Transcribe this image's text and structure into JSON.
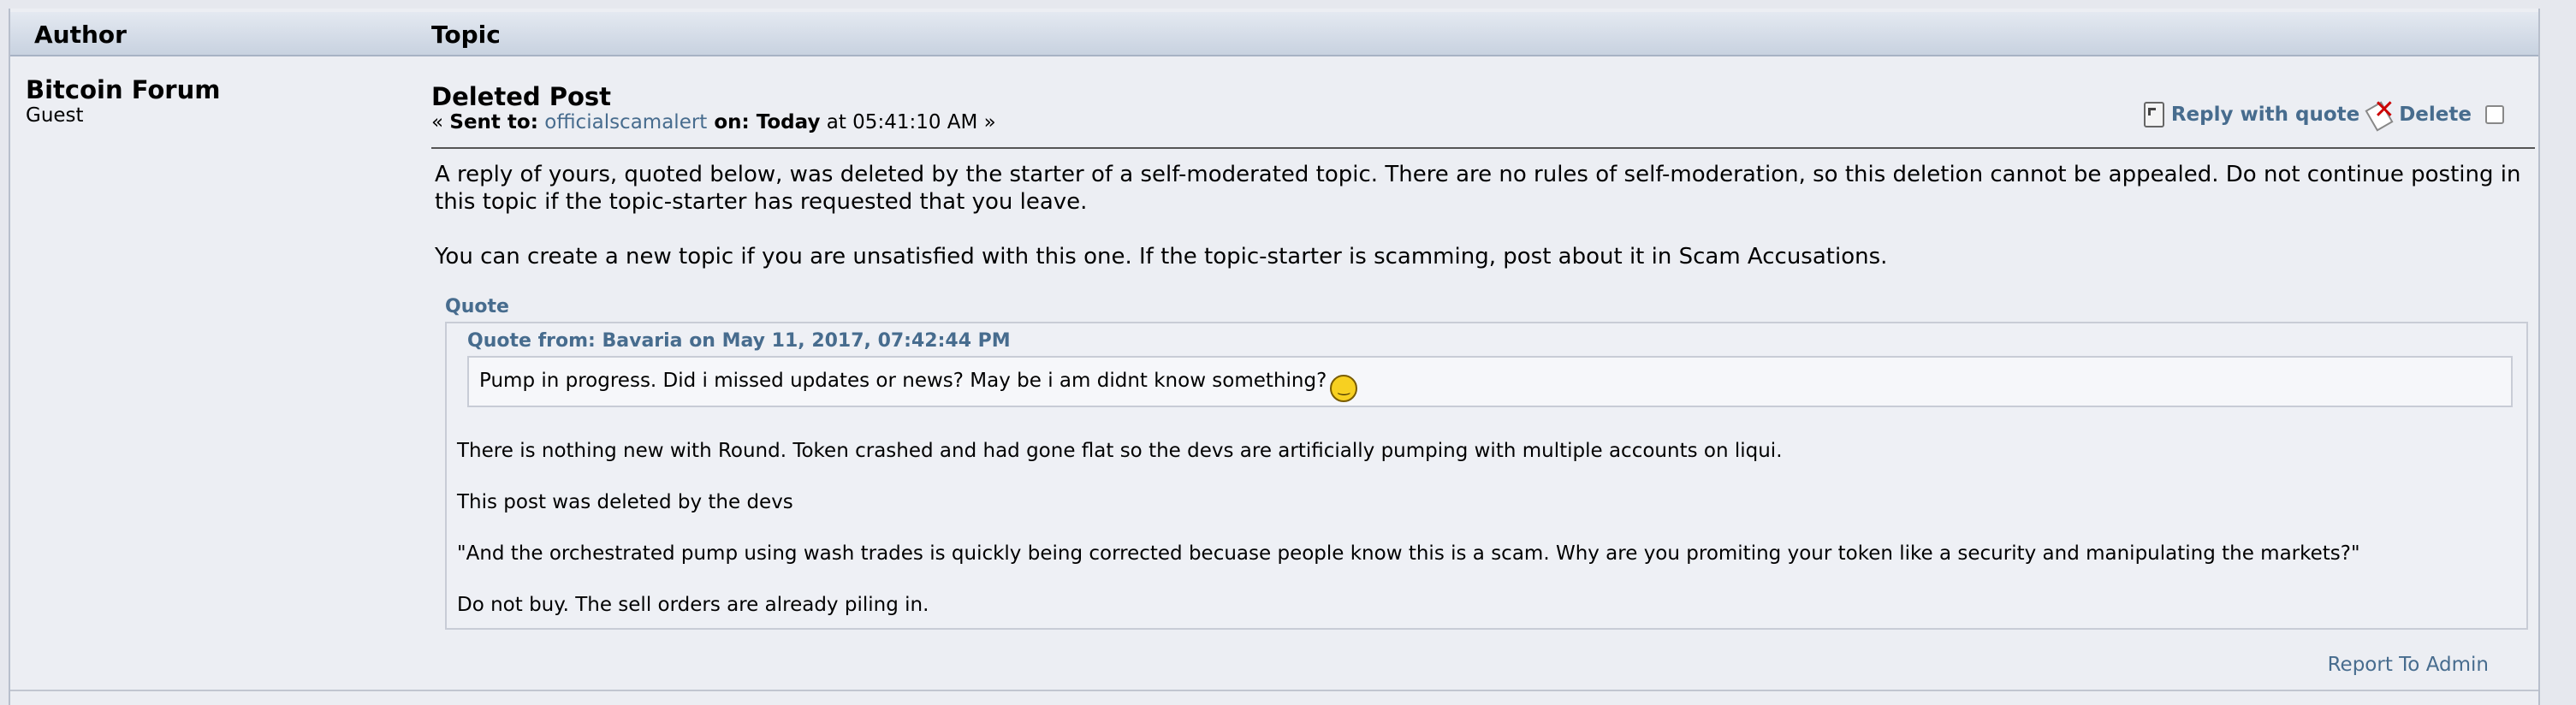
{
  "header": {
    "author_label": "Author",
    "topic_label": "Topic"
  },
  "author": {
    "name": "Bitcoin Forum",
    "role": "Guest"
  },
  "post": {
    "title": "Deleted Post",
    "meta_prefix": "« ",
    "sent_to_label": "Sent to:",
    "recipient": "officialscamalert",
    "on_label": " on:",
    "date_bold": " Today",
    "time": " at 05:41:10 AM »",
    "paragraph1": "A reply of yours, quoted below, was deleted by the starter of a self-moderated topic. There are no rules of self-moderation, so this deletion cannot be appealed. Do not continue posting in this topic if the topic-starter has requested that you leave.",
    "paragraph2": "You can create a new topic if you are unsatisfied with this one. If the topic-starter is scamming, post about it in Scam Accusations."
  },
  "actions": {
    "reply_with_quote": "Reply with quote",
    "delete": "Delete"
  },
  "quote": {
    "label": "Quote",
    "inner_header": "Quote from: Bavaria on May 11, 2017, 07:42:44 PM",
    "inner_text": "Pump in progress. Did i missed updates or news? May be i am didnt know something?",
    "lines": [
      "There is nothing new with Round. Token crashed and had gone flat so the devs are artificially pumping with multiple accounts on liqui.",
      "This post was deleted by the devs",
      "\"And the orchestrated pump using wash trades is quickly being corrected becuase people know this is a scam. Why are you promiting your token like a security and manipulating the markets?\"",
      "Do not buy. The sell orders are already piling in."
    ]
  },
  "footer": {
    "report": "Report To Admin"
  },
  "icons": {
    "reply": "quote-icon",
    "delete": "delete-icon",
    "smiley": "smiley-icon"
  },
  "colors": {
    "link": "#476c8e",
    "background": "#eceef3"
  }
}
